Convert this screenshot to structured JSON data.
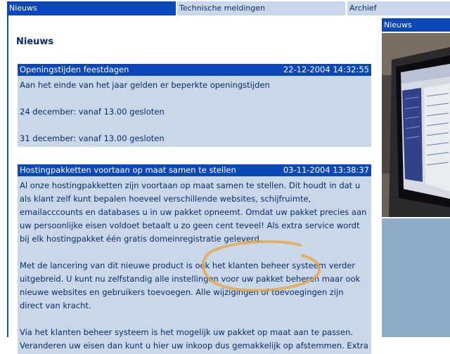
{
  "tabs": [
    {
      "label": "Nieuws",
      "active": true
    },
    {
      "label": "Technische meldingen",
      "active": false
    },
    {
      "label": "Archief",
      "active": false
    }
  ],
  "main": {
    "title": "Nieuws",
    "items": [
      {
        "title": "Openingstijden feestdagen",
        "date": "22-12-2004 14:32:55",
        "paragraphs": [
          "Aan het einde van het jaar gelden er beperkte openingstijden",
          "24 december: vanaf 13.00 gesloten",
          "31 december: vanaf 13.00 gesloten"
        ]
      },
      {
        "title": "Hostingpakketten voortaan op maat samen te stellen",
        "date": "03-11-2004 13:38:37",
        "paragraphs": [
          "Al onze hostingpakketten zijn voortaan op maat samen te stellen. Dit houdt in dat u als klant zelf kunt bepalen hoeveel verschillende websites, schijfruimte, emailacccounts en databases u in uw pakket opneemt. Omdat uw pakket precies aan uw persoonlijke eisen voldoet betaalt u zo geen cent teveel! Als extra service wordt bij elk hostingpakket één gratis domeinregistratie geleverd.",
          "Met de lancering van dit nieuwe product is ook het klanten beheer systeem verder uitgebreid. U kunt nu zelfstandig alle instellingen voor uw pakket beheren maar ook nieuwe websites en gebruikers toevoegen. Alle wijzigingen of toevoegingen zijn direct van kracht.",
          "Via het klanten beheer systeem is het mogelijk uw pakket op maat aan te passen. Veranderen uw eisen dan kunt u hier uw inkoop dus gemakkelijk op afstemmen. Extra"
        ]
      }
    ]
  },
  "sidebar": {
    "header": "Nieuws"
  },
  "colors": {
    "accent": "#0a47b8",
    "tab_inactive": "#c9d8e9",
    "item_bg": "#c9d8e9",
    "text": "#0a2a6b",
    "side_panel": "#8cabc9",
    "highlight": "#e8a33c"
  }
}
